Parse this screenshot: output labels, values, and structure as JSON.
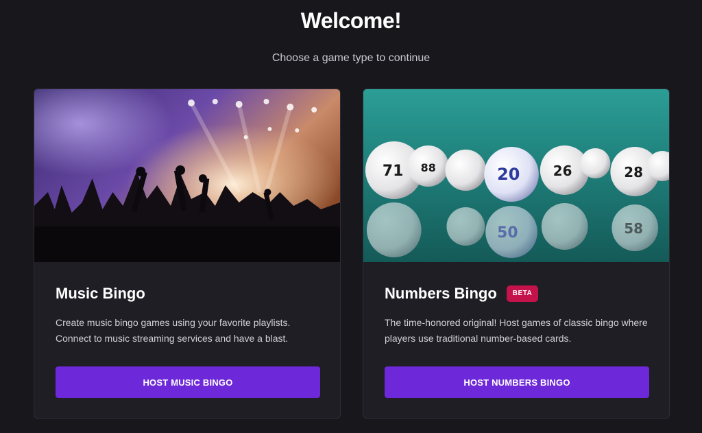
{
  "header": {
    "title": "Welcome!",
    "subtitle": "Choose a game type to continue"
  },
  "cards": [
    {
      "title": "Music Bingo",
      "description": "Create music bingo games using your favorite playlists. Connect to music streaming services and have a blast.",
      "button_label": "HOST MUSIC BINGO",
      "image": "concert-crowd-image"
    },
    {
      "title": "Numbers Bingo",
      "badge": "BETA",
      "description": "The time-honored original! Host games of classic bingo where players use traditional number-based cards.",
      "button_label": "HOST NUMBERS BINGO",
      "image": "bingo-balls-image"
    }
  ],
  "colors": {
    "background": "#18171c",
    "card": "#1f1e24",
    "button": "#6d28d9",
    "badge": "#c4124b"
  }
}
